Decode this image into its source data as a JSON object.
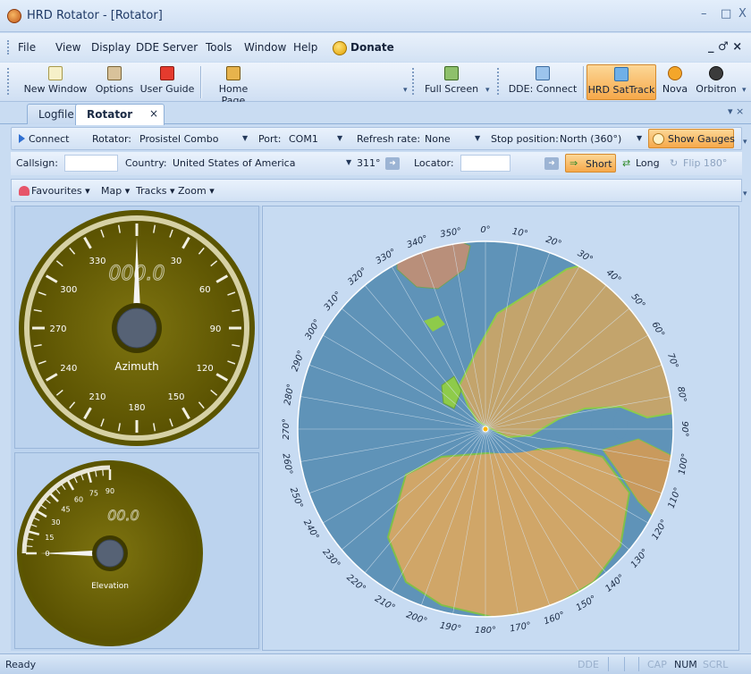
{
  "window": {
    "title": "HRD Rotator - [Rotator]",
    "minimize": "–",
    "maximize": "□",
    "close": "X"
  },
  "menu": {
    "items": [
      "File",
      "View",
      "Display",
      "DDE Server",
      "Tools",
      "Window",
      "Help"
    ],
    "donate": "Donate",
    "mdi_controls": "_ ♂ ×"
  },
  "toolbar": {
    "new_window": "New Window",
    "options": "Options",
    "user_guide": "User Guide",
    "home_page": "Home Page",
    "full_screen": "Full Screen",
    "dde_connect": "DDE: Connect",
    "hrd_sattrack": "HRD SatTrack",
    "nova": "Nova",
    "orbitron": "Orbitron"
  },
  "tabs": [
    {
      "label": "Logfile"
    },
    {
      "label": "Rotator"
    }
  ],
  "tab_close": "×",
  "tabstrip_controls": "▾ ×",
  "connection": {
    "connect": "Connect",
    "rotator_label": "Rotator:",
    "rotator_value": "Prosistel Combo",
    "port_label": "Port:",
    "port_value": "COM1",
    "refresh_label": "Refresh rate:",
    "refresh_value": "None",
    "stop_label": "Stop position:",
    "stop_value": "North (360°)",
    "show_gauges": "Show Gauges"
  },
  "location": {
    "callsign_label": "Callsign:",
    "callsign_value": "",
    "country_label": "Country:",
    "country_value": "United States of America",
    "bearing": "311°",
    "locator_label": "Locator:",
    "locator_value": "",
    "short": "Short",
    "long": "Long",
    "flip": "Flip 180°"
  },
  "favbar": {
    "favourites": "Favourites ▾",
    "map": "Map ▾",
    "tracks": "Tracks ▾",
    "zoom": "Zoom ▾"
  },
  "azimuth_gauge": {
    "readout": "000.0",
    "label": "Azimuth",
    "scale": [
      "330",
      "30",
      "300",
      "60",
      "270",
      "90",
      "240",
      "120",
      "210",
      "150",
      "180"
    ],
    "value_deg": 0
  },
  "elevation_gauge": {
    "readout": "00.0",
    "label": "Elevation",
    "scale": [
      "0",
      "15",
      "30",
      "45",
      "60",
      "75",
      "90"
    ],
    "value_deg": 0
  },
  "map": {
    "bearing_labels": [
      "0°",
      "10°",
      "20°",
      "30°",
      "40°",
      "50°",
      "60°",
      "70°",
      "80°",
      "90°",
      "100°",
      "110°",
      "120°",
      "130°",
      "140°",
      "150°",
      "160°",
      "170°",
      "180°",
      "190°",
      "200°",
      "210°",
      "220°",
      "230°",
      "240°",
      "250°",
      "260°",
      "270°",
      "280°",
      "290°",
      "300°",
      "310°",
      "320°",
      "330°",
      "340°",
      "350°"
    ],
    "ocean_color": "#5f93b8",
    "land_color": "#c3a46c"
  },
  "status": {
    "ready": "Ready",
    "dde": "DDE",
    "cap": "CAP",
    "num": "NUM",
    "scrl": "SCRL"
  }
}
